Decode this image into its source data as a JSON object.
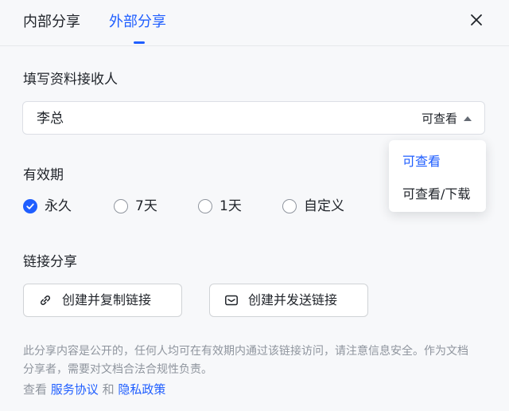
{
  "tabs": {
    "internal": "内部分享",
    "external": "外部分享"
  },
  "recipient": {
    "section_title": "填写资料接收人",
    "value": "李总",
    "permission": "可查看",
    "dropdown": [
      "可查看",
      "可查看/下载"
    ]
  },
  "validity": {
    "section_title": "有效期",
    "options": [
      "永久",
      "7天",
      "1天",
      "自定义"
    ],
    "selected": "永久"
  },
  "link_share": {
    "section_title": "链接分享",
    "copy_button": "创建并复制链接",
    "send_button": "创建并发送链接"
  },
  "notice": "此分享内容是公开的，任何人均可在有效期内通过该链接访问，请注意信息安全。作为文档分享者，需要对文档合法合规性负责。",
  "terms": {
    "prefix": "查看",
    "service": "服务协议",
    "and": "和",
    "privacy": "隐私政策"
  },
  "colors": {
    "accent": "#1f5eff",
    "text": "#1f2329",
    "muted": "#8f959e"
  }
}
